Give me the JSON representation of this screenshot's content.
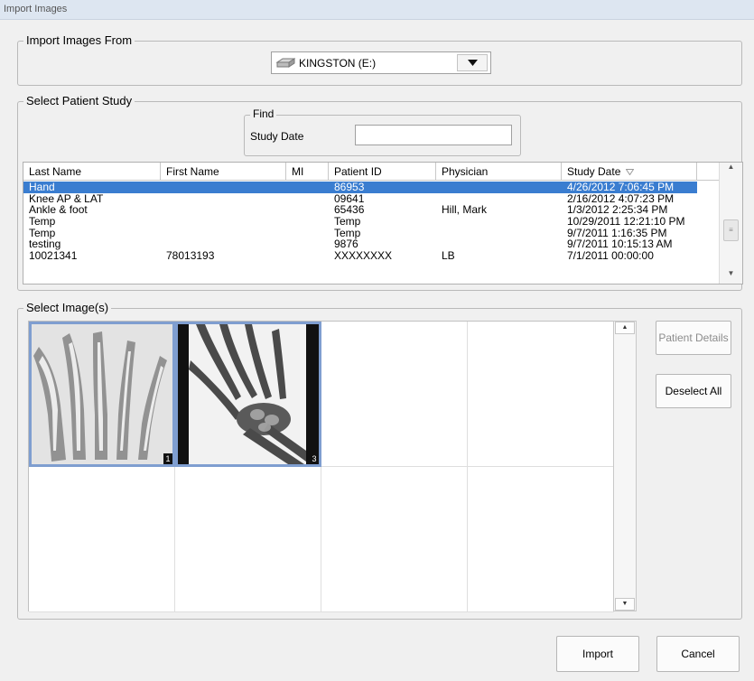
{
  "window": {
    "title": "Import Images"
  },
  "import_from": {
    "legend": "Import Images From",
    "drive": {
      "icon": "drive-icon",
      "label": "KINGSTON (E:)"
    }
  },
  "patient_study": {
    "legend": "Select Patient Study",
    "find": {
      "legend": "Find",
      "label": "Study Date",
      "value": ""
    },
    "columns": [
      "Last Name",
      "First Name",
      "MI",
      "Patient ID",
      "Physician",
      "Study Date"
    ],
    "sort_column": "Study Date",
    "rows": [
      {
        "last": "Hand",
        "first": "",
        "mi": "",
        "pid": "86953",
        "physician": "",
        "date": "4/26/2012 7:06:45 PM",
        "selected": true
      },
      {
        "last": "Knee AP & LAT",
        "first": "",
        "mi": "",
        "pid": "09641",
        "physician": "",
        "date": "2/16/2012 4:07:23 PM"
      },
      {
        "last": "Ankle & foot",
        "first": "",
        "mi": "",
        "pid": "65436",
        "physician": "Hill, Mark",
        "date": "1/3/2012 2:25:34 PM"
      },
      {
        "last": "Temp",
        "first": "",
        "mi": "",
        "pid": "Temp",
        "physician": "",
        "date": "10/29/2011 12:21:10 PM"
      },
      {
        "last": "Temp",
        "first": "",
        "mi": "",
        "pid": "Temp",
        "physician": "",
        "date": "9/7/2011 1:16:35 PM"
      },
      {
        "last": "testing",
        "first": "",
        "mi": "",
        "pid": "9876",
        "physician": "",
        "date": "9/7/2011 10:15:13 AM"
      },
      {
        "last": "10021341",
        "first": "78013193",
        "mi": "",
        "pid": "XXXXXXXX",
        "physician": "LB",
        "date": "7/1/2011 00:00:00"
      }
    ]
  },
  "images": {
    "legend": "Select Image(s)",
    "thumbnails": [
      {
        "number": "1",
        "selected": true
      },
      {
        "number": "3",
        "selected": true
      }
    ]
  },
  "buttons": {
    "patient_details": "Patient Details",
    "deselect_all": "Deselect All",
    "import": "Import",
    "cancel": "Cancel"
  },
  "colors": {
    "selection": "#3a7dd0",
    "thumb_border": "#7f9ed0",
    "title_bar": "#dde6f1"
  }
}
